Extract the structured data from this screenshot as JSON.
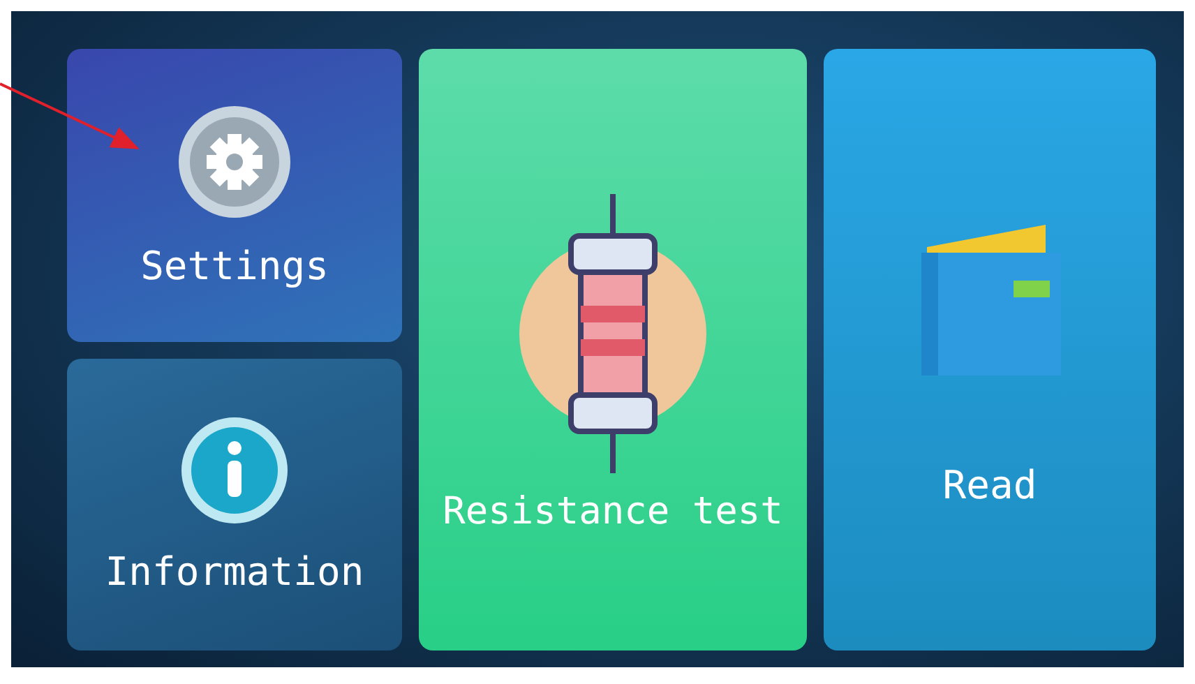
{
  "tiles": [
    {
      "kind": "settings",
      "label": "Settings"
    },
    {
      "kind": "information",
      "label": "Information"
    },
    {
      "kind": "resistance",
      "label": "Resistance test"
    },
    {
      "kind": "read",
      "label": "Read"
    }
  ]
}
